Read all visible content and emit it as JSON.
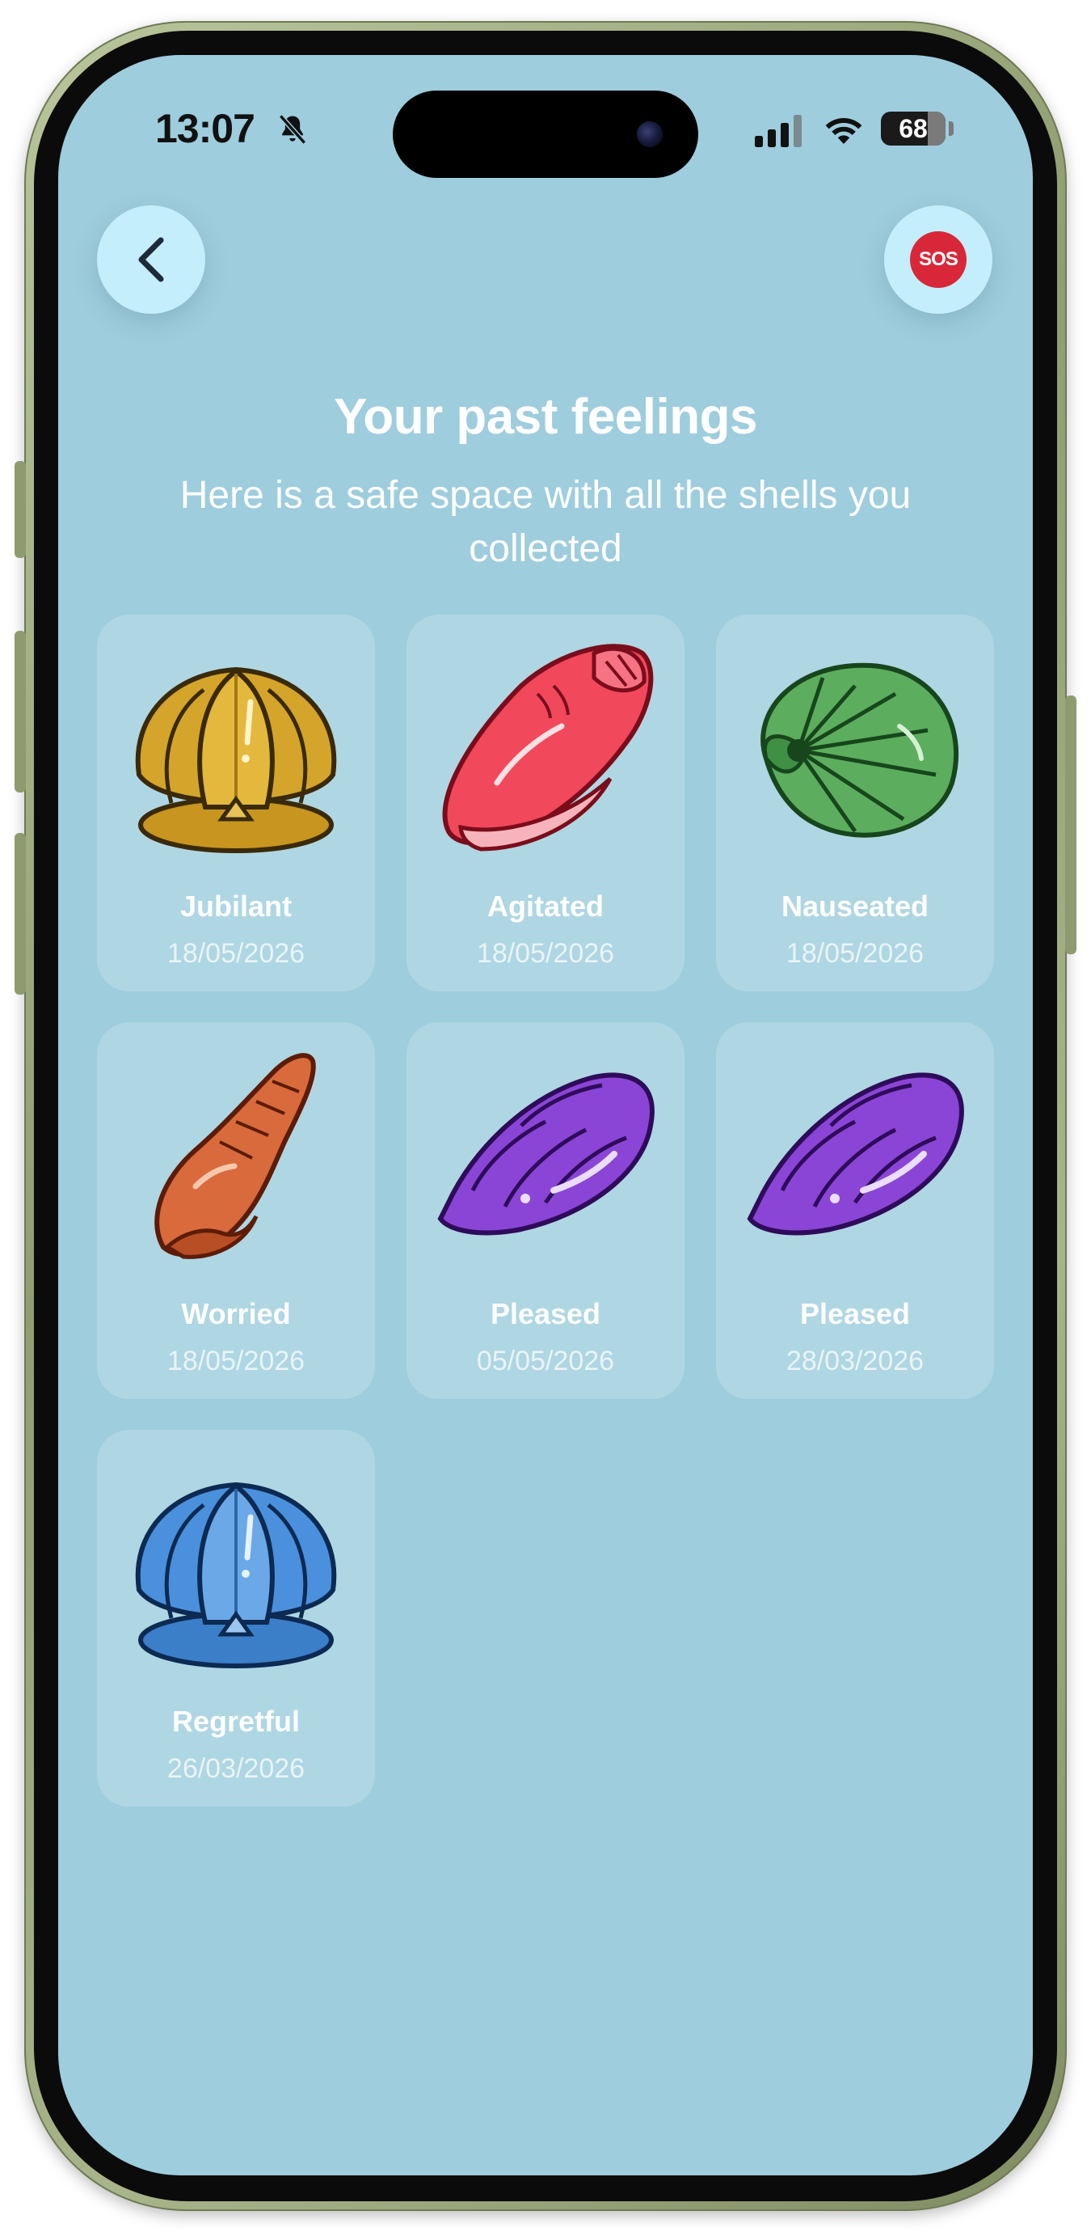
{
  "status_bar": {
    "time": "13:07",
    "battery": "68",
    "icons": [
      "bell-slash-icon",
      "cellular-signal-icon",
      "wifi-icon",
      "battery-icon"
    ]
  },
  "nav": {
    "back_icon": "chevron-left-icon",
    "sos_label": "SOS"
  },
  "header": {
    "title": "Your past feelings",
    "subtitle": "Here is a safe space with all the shells you collected"
  },
  "colors": {
    "background": "#9ecddd",
    "button": "#c4eefb",
    "sos_red": "#d9273a",
    "text": "#ffffff"
  },
  "shells": [
    {
      "name": "Jubilant",
      "date": "18/05/2026",
      "icon": "scallop-shell-icon",
      "color": "#d4a52a"
    },
    {
      "name": "Agitated",
      "date": "18/05/2026",
      "icon": "conch-shell-icon",
      "color": "#f2485c"
    },
    {
      "name": "Nauseated",
      "date": "18/05/2026",
      "icon": "nautilus-shell-icon",
      "color": "#5cae5e"
    },
    {
      "name": "Worried",
      "date": "18/05/2026",
      "icon": "spiral-shell-icon",
      "color": "#d96a3c"
    },
    {
      "name": "Pleased",
      "date": "05/05/2026",
      "icon": "cowrie-shell-icon",
      "color": "#8a45d6"
    },
    {
      "name": "Pleased",
      "date": "28/03/2026",
      "icon": "cowrie-shell-icon",
      "color": "#8a45d6"
    },
    {
      "name": "Regretful",
      "date": "26/03/2026",
      "icon": "scallop-shell-icon",
      "color": "#4a90dc"
    }
  ]
}
